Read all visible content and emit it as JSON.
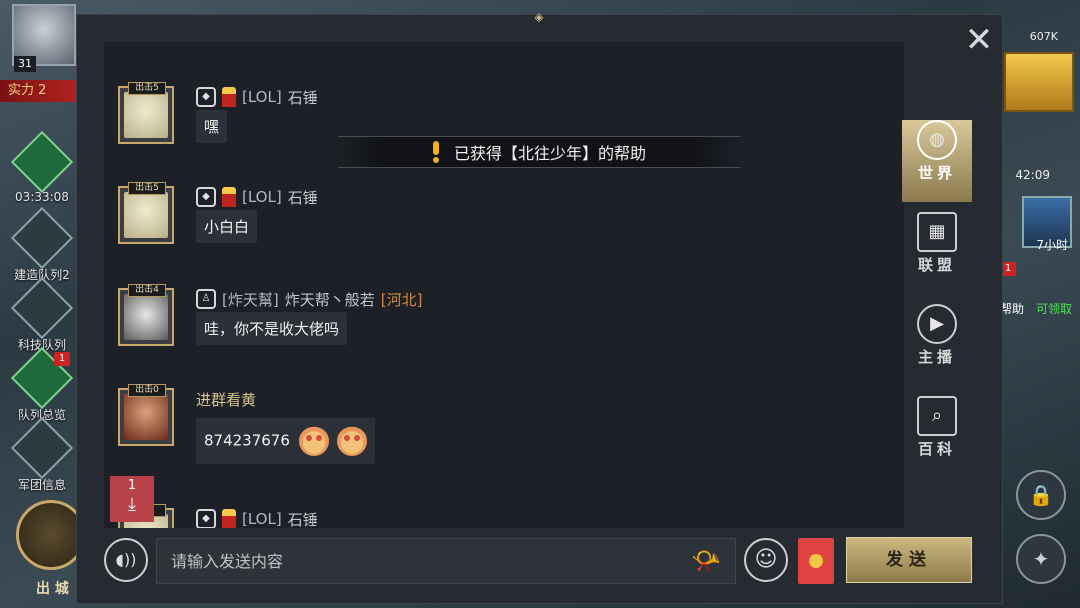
{
  "left_hud": {
    "hero_level": "31",
    "power_label": "实力 2",
    "queues": [
      {
        "label": "03:33:08",
        "badge": ""
      },
      {
        "label": "建造队列2",
        "badge": ""
      },
      {
        "label": "科技队列",
        "badge": ""
      },
      {
        "label": "队列总览",
        "badge": "1"
      },
      {
        "label": "军团信息",
        "badge": ""
      }
    ],
    "city_label": "出 城"
  },
  "right_hud": {
    "gold": "607K",
    "timer": "42:09",
    "castle_timer": "7小时",
    "help_label": "帮助",
    "help_badge": "1",
    "claim_label": "可领取"
  },
  "chat": {
    "notice": "已获得【北往少年】的帮助",
    "messages": [
      {
        "rank_tag": "出击5",
        "guild": "[LOL]",
        "name": "石锤",
        "location": "",
        "text": "嘿",
        "face": "blond"
      },
      {
        "rank_tag": "出击5",
        "guild": "[LOL]",
        "name": "石锤",
        "location": "",
        "text": "小白白",
        "face": "blond"
      },
      {
        "rank_tag": "出击4",
        "guild": "[炸天幫]",
        "name": "炸天帮丶般若",
        "location": "[河北]",
        "text": "哇，你不是收大佬吗",
        "face": "mono"
      },
      {
        "rank_tag": "出击0",
        "guild": "",
        "name": "进群看黄",
        "location": "",
        "text": "874237676",
        "face": "warrior"
      },
      {
        "rank_tag": "5",
        "guild": "[LOL]",
        "name": "石锤",
        "location": "",
        "text": "",
        "face": "blond"
      }
    ],
    "unread_count": "1",
    "tabs": [
      {
        "label": "世界",
        "icon": "globe-chat-icon",
        "active": true
      },
      {
        "label": "联盟",
        "icon": "alliance-chat-icon",
        "active": false
      },
      {
        "label": "主播",
        "icon": "play-icon",
        "active": false
      },
      {
        "label": "百科",
        "icon": "book-search-icon",
        "active": false
      }
    ],
    "input_placeholder": "请输入发送内容",
    "send_label": "发送"
  },
  "colors": {
    "panel": "#262a31",
    "messages_bg": "#1d2026",
    "gold_accent": "#c8a96a",
    "location_text": "#d38a3d",
    "unread_red": "#b94148"
  }
}
